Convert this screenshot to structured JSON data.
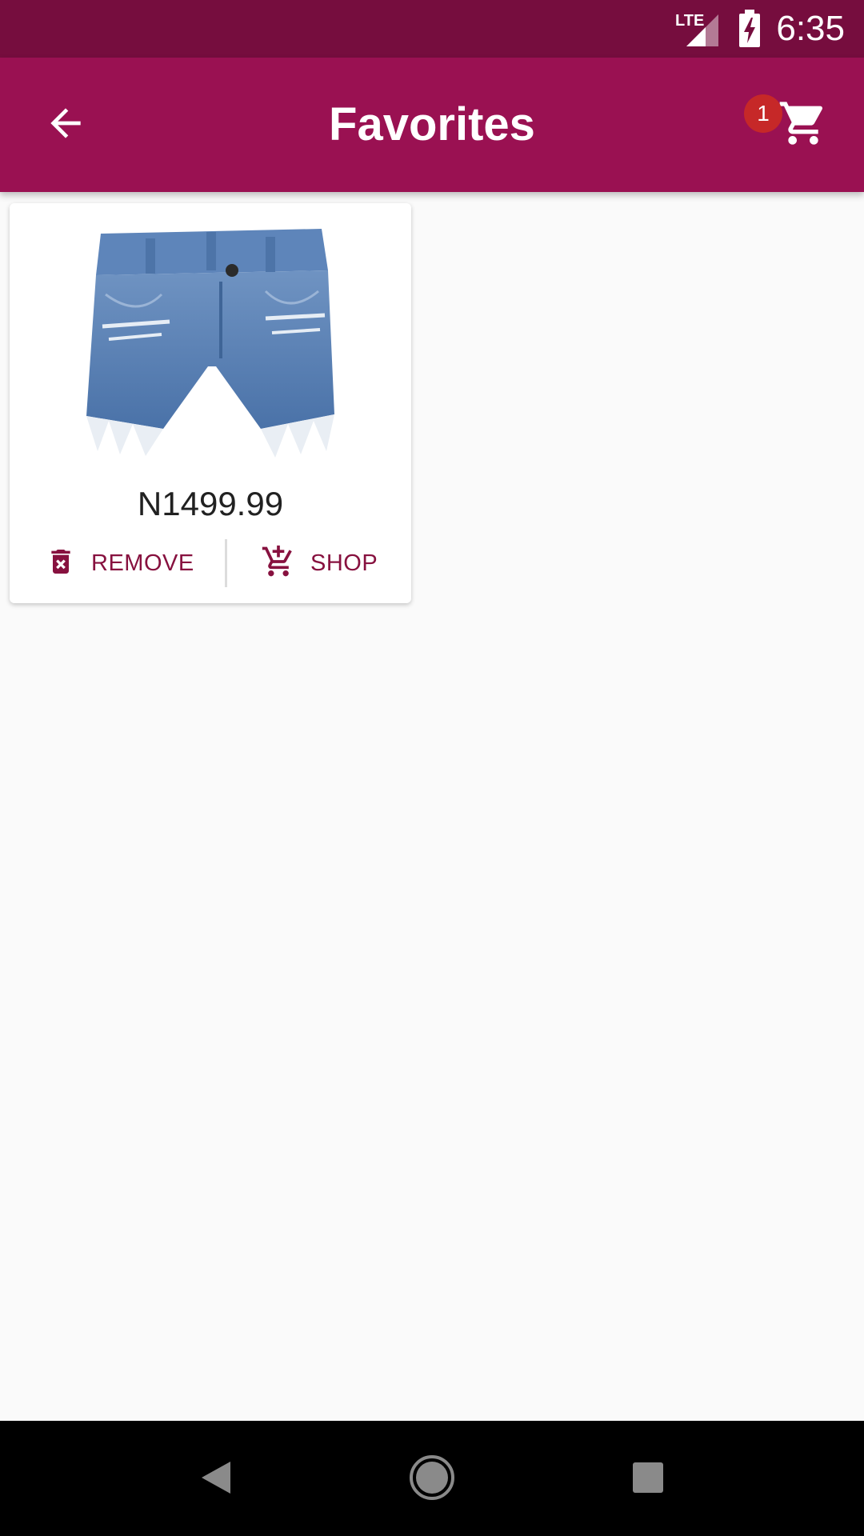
{
  "status_bar": {
    "time": "6:35",
    "network_label": "LTE",
    "icons": [
      "lte-signal-icon",
      "battery-charging-icon"
    ]
  },
  "app_bar": {
    "title": "Favorites",
    "back_icon": "arrow-back-icon",
    "cart_icon": "shopping-cart-icon",
    "cart_badge_count": "1"
  },
  "favorites": {
    "items": [
      {
        "image_icon": "denim-shorts-image",
        "price": "N1499.99",
        "remove_label": "REMOVE",
        "remove_icon": "delete-forever-icon",
        "shop_label": "SHOP",
        "shop_icon": "add-shopping-cart-icon"
      }
    ]
  },
  "nav_bar": {
    "icons": [
      "back-triangle-icon",
      "home-circle-icon",
      "recents-square-icon"
    ]
  },
  "colors": {
    "status_bar": "#760d3e",
    "app_bar": "#9a1152",
    "accent_text": "#87113f",
    "badge": "#c62828",
    "background": "#fafafa"
  }
}
